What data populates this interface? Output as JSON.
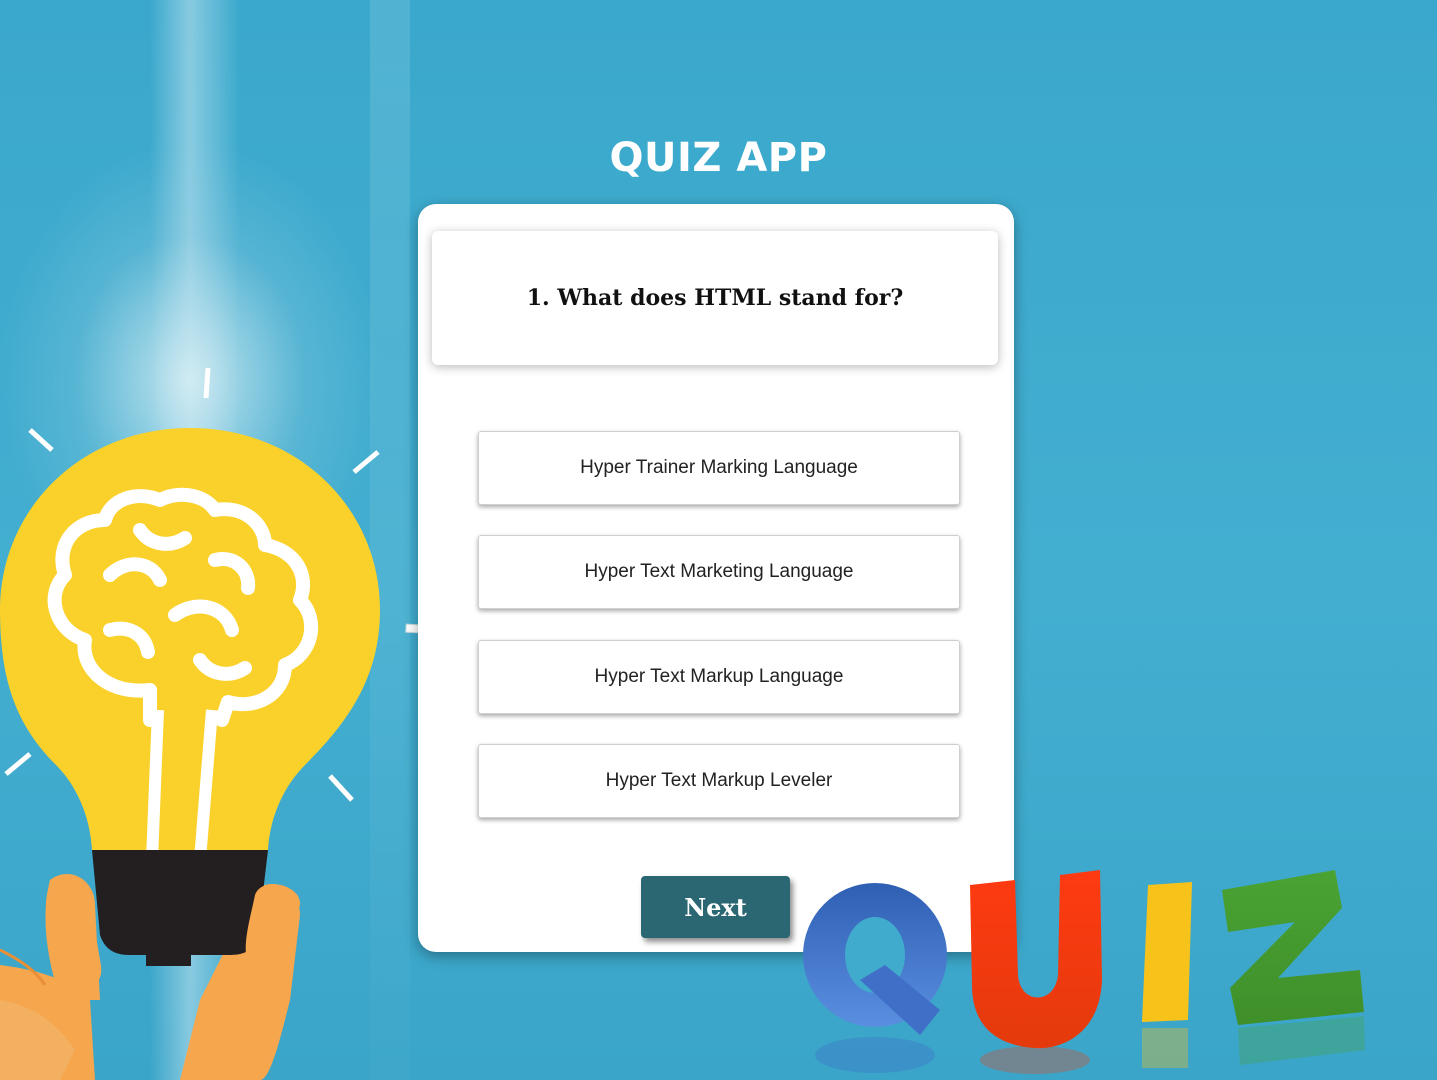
{
  "app": {
    "title": "QUIZ APP"
  },
  "question": {
    "text": "1. What does HTML stand for?"
  },
  "options": [
    {
      "label": "Hyper Trainer Marking Language"
    },
    {
      "label": "Hyper Text Marketing Language"
    },
    {
      "label": "Hyper Text Markup Language"
    },
    {
      "label": "Hyper Text Markup Leveler"
    }
  ],
  "controls": {
    "next_label": "Next"
  },
  "decoration": {
    "quiz_letters": [
      "Q",
      "U",
      "I",
      "Z"
    ]
  },
  "colors": {
    "background": "#41abcd",
    "next_button": "#2b6673",
    "bulb": "#fad12a",
    "hand": "#f6a64c",
    "q": "#3f6fc7",
    "u": "#f24012",
    "i": "#f7c31b",
    "z": "#4aa333"
  },
  "icons": {
    "illustration": "lightbulb-brain-icon"
  }
}
